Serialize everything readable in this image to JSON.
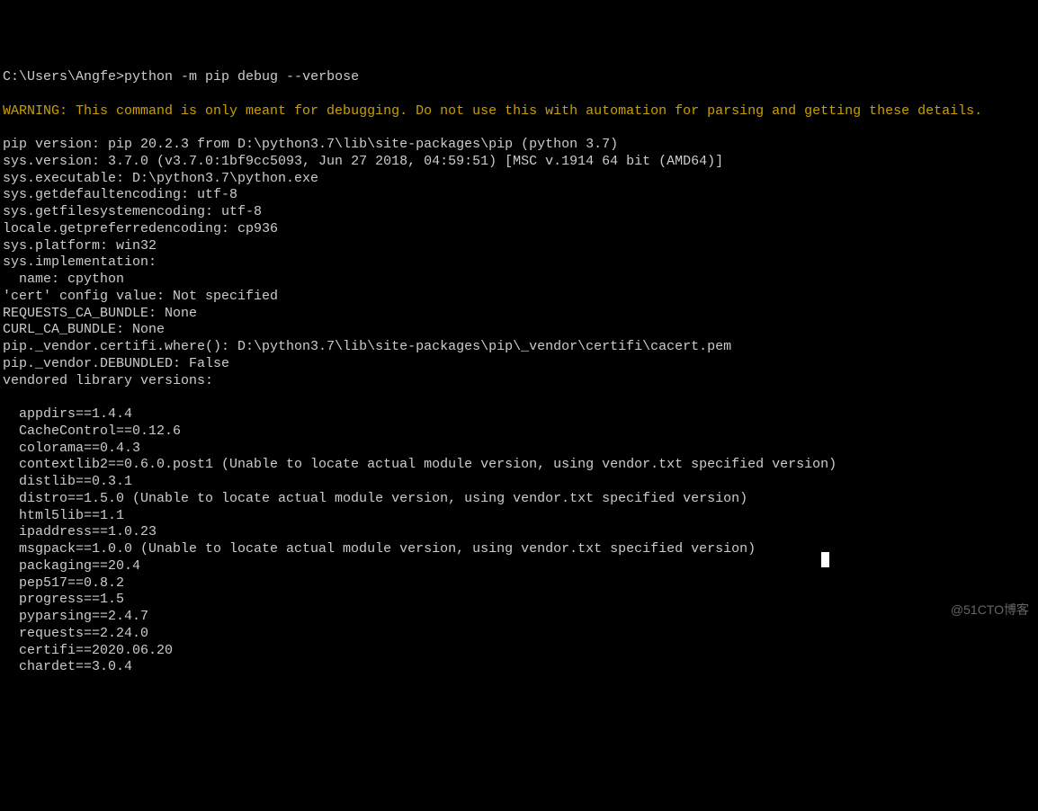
{
  "prompt": "C:\\Users\\Angfe>",
  "command": "python -m pip debug --verbose",
  "warning": "WARNING: This command is only meant for debugging. Do not use this with automation for parsing and getting these details.",
  "info_lines": [
    "pip version: pip 20.2.3 from D:\\python3.7\\lib\\site-packages\\pip (python 3.7)",
    "sys.version: 3.7.0 (v3.7.0:1bf9cc5093, Jun 27 2018, 04:59:51) [MSC v.1914 64 bit (AMD64)]",
    "sys.executable: D:\\python3.7\\python.exe",
    "sys.getdefaultencoding: utf-8",
    "sys.getfilesystemencoding: utf-8",
    "locale.getpreferredencoding: cp936",
    "sys.platform: win32",
    "sys.implementation:",
    "  name: cpython",
    "'cert' config value: Not specified",
    "REQUESTS_CA_BUNDLE: None",
    "CURL_CA_BUNDLE: None",
    "pip._vendor.certifi.where(): D:\\python3.7\\lib\\site-packages\\pip\\_vendor\\certifi\\cacert.pem",
    "pip._vendor.DEBUNDLED: False",
    "vendored library versions:"
  ],
  "vendored": [
    "appdirs==1.4.4",
    "CacheControl==0.12.6",
    "colorama==0.4.3",
    "contextlib2==0.6.0.post1 (Unable to locate actual module version, using vendor.txt specified version)",
    "distlib==0.3.1",
    "distro==1.5.0 (Unable to locate actual module version, using vendor.txt specified version)",
    "html5lib==1.1",
    "ipaddress==1.0.23",
    "msgpack==1.0.0 (Unable to locate actual module version, using vendor.txt specified version)",
    "packaging==20.4",
    "pep517==0.8.2",
    "progress==1.5",
    "pyparsing==2.4.7",
    "requests==2.24.0",
    "certifi==2020.06.20",
    "chardet==3.0.4"
  ],
  "watermark": "@51CTO博客"
}
